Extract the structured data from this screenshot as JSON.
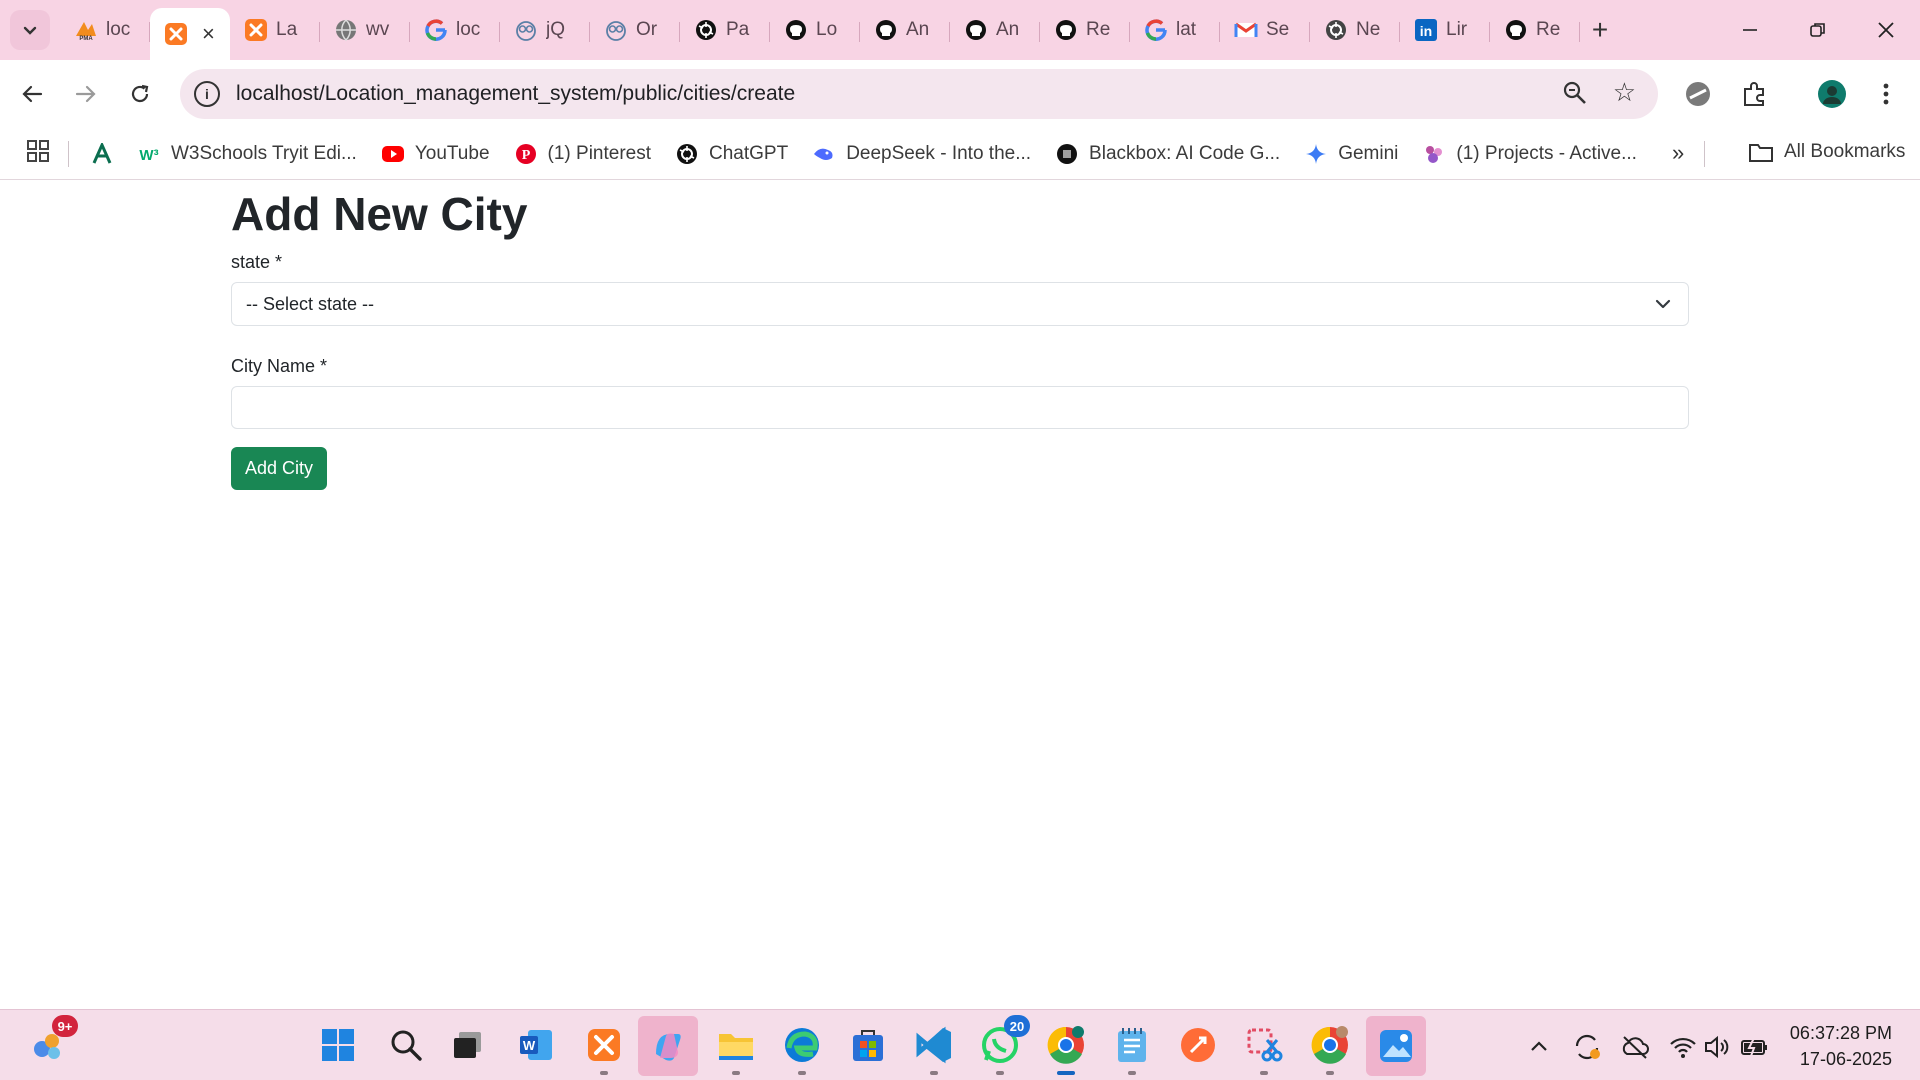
{
  "browser": {
    "tabs": [
      {
        "title": "loc",
        "icon": "phpmyadmin-icon",
        "color": "#f28c1e"
      },
      {
        "title": "",
        "icon": "xampp-icon",
        "color": "#fb7a24",
        "active": true
      },
      {
        "title": "La",
        "icon": "xampp-icon",
        "color": "#fb7a24"
      },
      {
        "title": "wv",
        "icon": "globe-icon",
        "color": "#777777"
      },
      {
        "title": "loc",
        "icon": "google-icon",
        "color": "#4285f4"
      },
      {
        "title": "jQ",
        "icon": "owl-icon",
        "color": "#5b7fa6"
      },
      {
        "title": "Or",
        "icon": "owl-icon",
        "color": "#5b7fa6"
      },
      {
        "title": "Pa",
        "icon": "chatgpt-icon",
        "color": "#111111"
      },
      {
        "title": "Lo",
        "icon": "github-icon",
        "color": "#111111"
      },
      {
        "title": "An",
        "icon": "github-icon",
        "color": "#111111"
      },
      {
        "title": "An",
        "icon": "github-icon",
        "color": "#111111"
      },
      {
        "title": "Re",
        "icon": "github-icon",
        "color": "#111111"
      },
      {
        "title": "lat",
        "icon": "google-icon",
        "color": "#4285f4"
      },
      {
        "title": "Se",
        "icon": "gmail-icon",
        "color": "#ea4335"
      },
      {
        "title": "Ne",
        "icon": "chatgpt-icon",
        "color": "#444444"
      },
      {
        "title": "Lir",
        "icon": "linkedin-icon",
        "color": "#0a66c2"
      },
      {
        "title": "Re",
        "icon": "github-icon",
        "color": "#111111"
      }
    ],
    "url": "localhost/Location_management_system/public/cities/create",
    "bookmarks": [
      {
        "label": "W3Schools Tryit Edi...",
        "icon": "w3schools-icon",
        "color": "#04aa6d"
      },
      {
        "label": "YouTube",
        "icon": "youtube-icon",
        "color": "#ff0000"
      },
      {
        "label": "(1) Pinterest",
        "icon": "pinterest-icon",
        "color": "#e60023"
      },
      {
        "label": "ChatGPT",
        "icon": "chatgpt-icon",
        "color": "#111111"
      },
      {
        "label": "DeepSeek - Into the...",
        "icon": "deepseek-icon",
        "color": "#4d6bfe"
      },
      {
        "label": "Blackbox: AI Code G...",
        "icon": "blackbox-icon",
        "color": "#111111"
      },
      {
        "label": "Gemini",
        "icon": "gemini-icon",
        "color": "#3c7bf4"
      },
      {
        "label": "(1) Projects - Active...",
        "icon": "projects-icon",
        "color": "#b84fa0"
      }
    ],
    "all_bookmarks": "All Bookmarks"
  },
  "page": {
    "title": "Add New City",
    "state_label": "state *",
    "state_selected": "-- Select state --",
    "city_label": "City Name *",
    "city_value": "",
    "submit_label": "Add City",
    "accent_color": "#198754"
  },
  "taskbar": {
    "widgets_badge": "9+",
    "whatsapp_badge": "20",
    "time": "06:37:28 PM",
    "date": "17-06-2025"
  }
}
